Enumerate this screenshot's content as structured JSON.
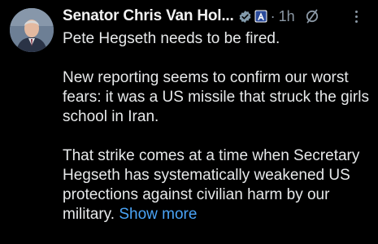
{
  "post": {
    "author_name": "Senator Chris Van Hol...",
    "separator": "·",
    "time": "1h",
    "paragraphs": [
      "Pete Hegseth needs to be fired.",
      "New reporting seems to confirm our worst fears: it was a US missile that struck the girls school in Iran.",
      "That strike comes at a time when Secretary Hegseth has systematically weakened US protections against civilian harm by our military."
    ],
    "show_more_label": "Show more"
  },
  "colors": {
    "background": "#000000",
    "text": "#e7e9ea",
    "muted": "#8b98a5",
    "link": "#4aa3f5",
    "verified": "#829aab"
  },
  "icons": {
    "verified": "verified-badge-icon",
    "gov": "government-affiliation-icon",
    "grok": "grok-icon",
    "more": "more-options-icon"
  }
}
